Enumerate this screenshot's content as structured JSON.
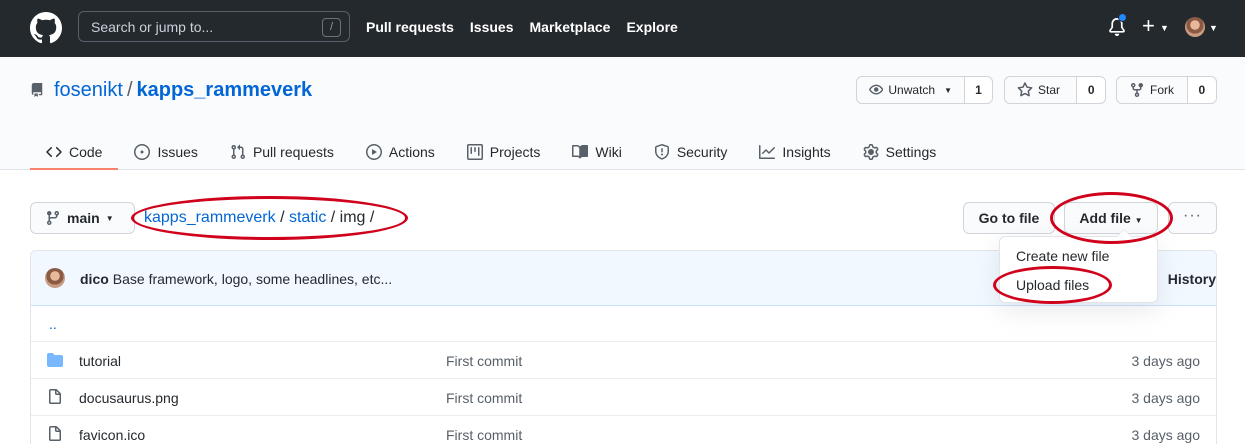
{
  "header": {
    "search_placeholder": "Search or jump to...",
    "search_shortcut": "/",
    "nav": [
      "Pull requests",
      "Issues",
      "Marketplace",
      "Explore"
    ],
    "plus_label": "+"
  },
  "repo": {
    "owner": "fosenikt",
    "separator": "/",
    "name": "kapps_rammeverk",
    "watch": {
      "label": "Unwatch",
      "count": "1"
    },
    "star": {
      "label": "Star",
      "count": "0"
    },
    "fork": {
      "label": "Fork",
      "count": "0"
    }
  },
  "tabs": [
    {
      "label": "Code",
      "icon": "code-icon",
      "active": true
    },
    {
      "label": "Issues",
      "icon": "issue-icon"
    },
    {
      "label": "Pull requests",
      "icon": "pull-request-icon"
    },
    {
      "label": "Actions",
      "icon": "play-icon"
    },
    {
      "label": "Projects",
      "icon": "project-icon"
    },
    {
      "label": "Wiki",
      "icon": "book-icon"
    },
    {
      "label": "Security",
      "icon": "shield-icon"
    },
    {
      "label": "Insights",
      "icon": "graph-icon"
    },
    {
      "label": "Settings",
      "icon": "gear-icon"
    }
  ],
  "file_nav": {
    "branch": "main",
    "breadcrumb": {
      "root": "kapps_rammeverk",
      "sep1": "/",
      "dir": "static",
      "sep2": "/",
      "current": "img",
      "sep3": "/"
    },
    "goto_label": "Go to file",
    "add_label": "Add file",
    "more_label": "···"
  },
  "dropdown": {
    "items": [
      "Create new file",
      "Upload files"
    ]
  },
  "commit": {
    "author": "dico",
    "message": "Base framework, logo, some headlines, etc...",
    "history_label": "History"
  },
  "files": {
    "up": "..",
    "rows": [
      {
        "name": "tutorial",
        "type": "folder",
        "message": "First commit",
        "age": "3 days ago"
      },
      {
        "name": "docusaurus.png",
        "type": "file",
        "message": "First commit",
        "age": "3 days ago"
      },
      {
        "name": "favicon.ico",
        "type": "file",
        "message": "First commit",
        "age": "3 days ago"
      }
    ]
  },
  "colors": {
    "header_bg": "#24292e",
    "link": "#0366d6",
    "tab_underline": "#f9826c",
    "annotation": "#d0021b",
    "folder": "#79b8ff"
  }
}
